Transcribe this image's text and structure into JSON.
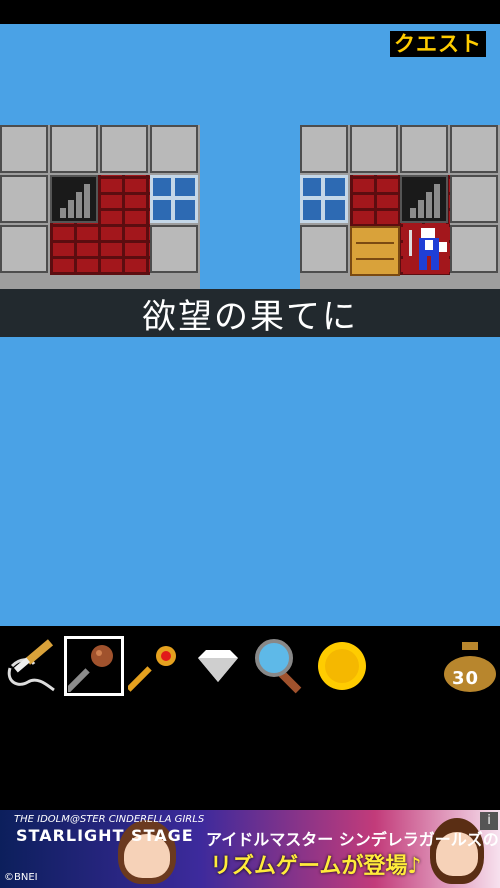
{
  "header": {
    "quest_logo": "クエスト"
  },
  "scene": {
    "caption": "欲望の果てに"
  },
  "inventory": {
    "items": [
      {
        "name": "rope-and-knife-icon"
      },
      {
        "name": "mace-icon",
        "selected": true
      },
      {
        "name": "red-gem-key-icon"
      },
      {
        "name": "diamond-icon"
      },
      {
        "name": "magnifying-glass-icon"
      },
      {
        "name": "gold-coin-icon"
      }
    ],
    "money_bag_count": "30"
  },
  "ad_banner": {
    "logo_small": "THE IDOLM@STER CINDERELLA GIRLS",
    "logo_big": "STARLIGHT STAGE",
    "line1": "アイドルマスター シンデレラガールズの",
    "line2": "リズムゲームが登場♪",
    "copyright": "©BNEI",
    "info": "i"
  },
  "colors": {
    "sky": "#4aa2e6",
    "brick": "#a3171c",
    "coin": "#ffcc00"
  }
}
